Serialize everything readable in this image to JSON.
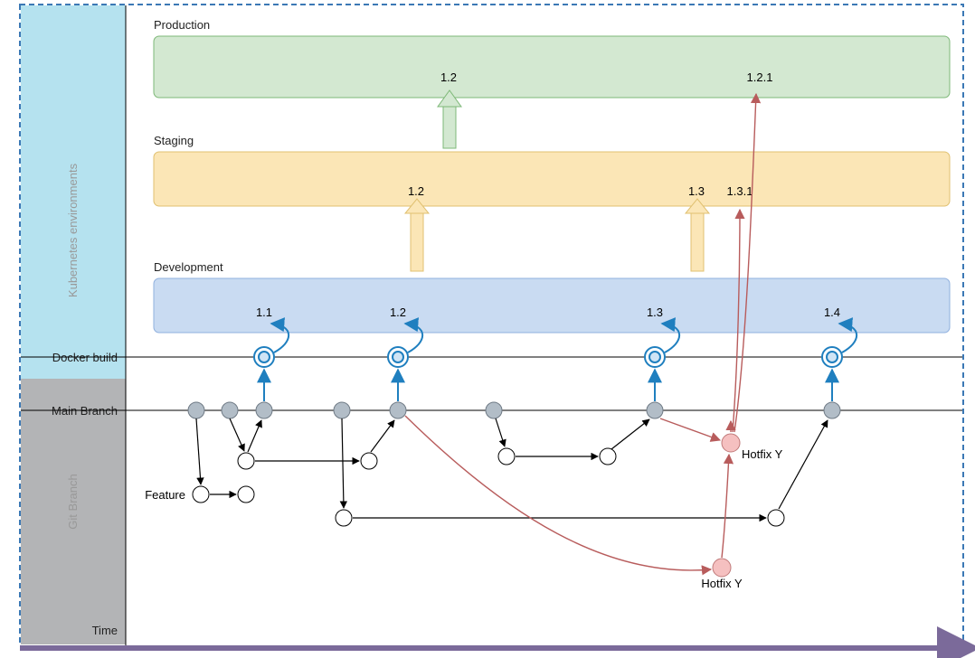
{
  "sidebar": {
    "kubernetes_label": "Kubernetes environments",
    "docker_label": "Docker build",
    "main_branch_label": "Main Branch",
    "git_branch_label": "Git Branch",
    "time_label": "Time"
  },
  "env": {
    "production": {
      "title": "Production",
      "versions": [
        "1.2",
        "1.2.1"
      ]
    },
    "staging": {
      "title": "Staging",
      "versions": [
        "1.2",
        "1.3",
        "1.3.1"
      ]
    },
    "development": {
      "title": "Development",
      "versions": [
        "1.1",
        "1.2",
        "1.3",
        "1.4"
      ]
    }
  },
  "branches": {
    "feature_label": "Feature",
    "hotfix_label": "Hotfix Y"
  },
  "colors": {
    "sidebar_blue": "#b5e2ef",
    "sidebar_gray": "#b3b4b6",
    "dash": "#3b78b5",
    "prod_fill": "#d3e8d1",
    "prod_stroke": "#7eb878",
    "stage_fill": "#fbe6b6",
    "stage_stroke": "#e0c070",
    "dev_fill": "#c9dbf2",
    "dev_stroke": "#8fb0de",
    "main_node": "#b2bdc7",
    "docker_stroke": "#1f7fbf",
    "hotfix_fill": "#f5c0c0",
    "hotfix_stroke": "#c07a7a",
    "time": "#7b6a9a"
  },
  "chart_data": {
    "type": "diagram",
    "description": "Git branching and promotion flow across Kubernetes environments over time",
    "environments": [
      "Development",
      "Staging",
      "Production"
    ],
    "deploys": {
      "Development": [
        "1.1",
        "1.2",
        "1.3",
        "1.4"
      ],
      "Staging": [
        "1.2",
        "1.3",
        "1.3.1"
      ],
      "Production": [
        "1.2",
        "1.2.1"
      ]
    },
    "promotions": [
      {
        "from": "Development",
        "to": "Staging",
        "version": "1.2"
      },
      {
        "from": "Development",
        "to": "Staging",
        "version": "1.3"
      },
      {
        "from": "Staging",
        "to": "Production",
        "version": "1.2"
      },
      {
        "from": "Hotfix Y",
        "to": "Staging",
        "version": "1.3.1"
      },
      {
        "from": "Hotfix Y",
        "to": "Production",
        "version": "1.2.1"
      }
    ],
    "git": {
      "main_commits": 8,
      "feature_branches": 4,
      "hotfix_branches": [
        {
          "name": "Hotfix Y",
          "targets": [
            "Staging 1.3.1",
            "Production 1.2.1",
            "Main Branch"
          ]
        }
      ]
    },
    "x_axis": "Time"
  }
}
